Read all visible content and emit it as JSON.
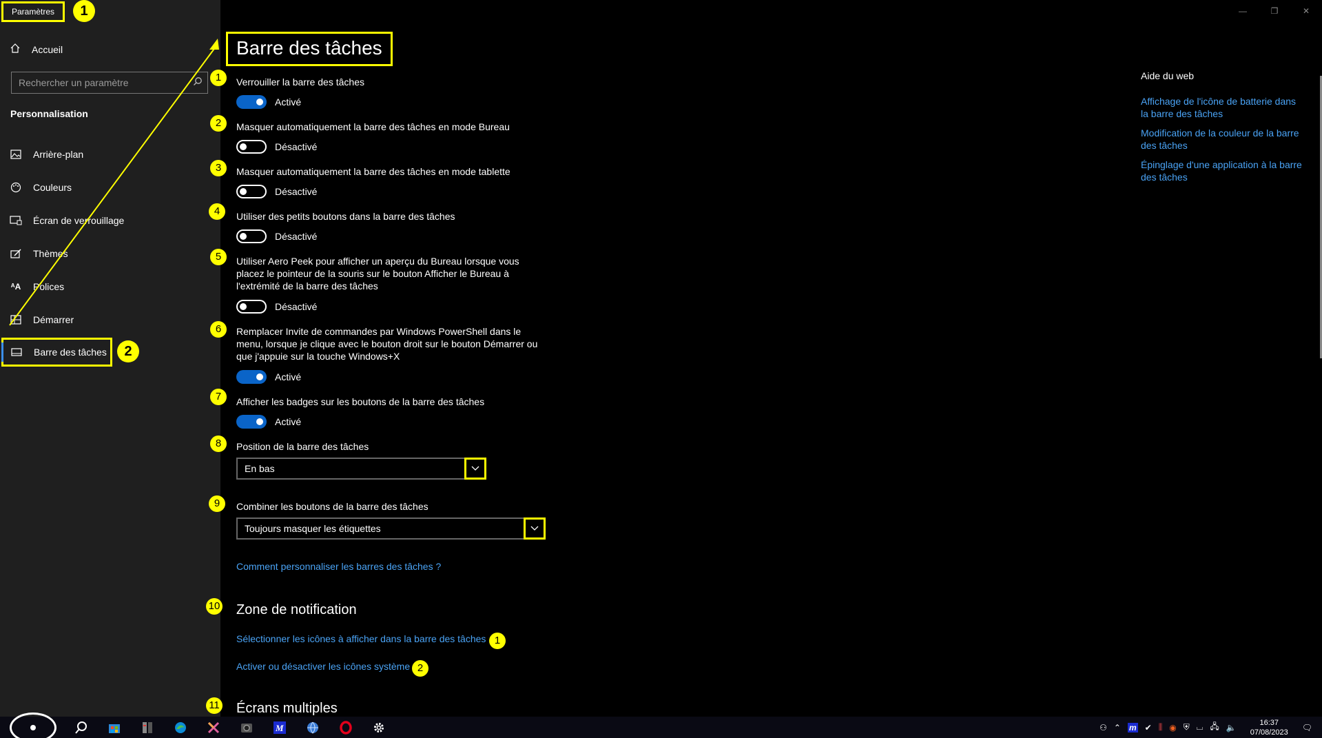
{
  "app": {
    "title": "Paramètres"
  },
  "annotations": {
    "app_title": "1",
    "active_nav": "2",
    "settings": [
      "1",
      "2",
      "3",
      "4",
      "5",
      "6",
      "7",
      "8",
      "9",
      "10",
      "11"
    ],
    "notif_links": [
      "1",
      "2"
    ]
  },
  "sidebar": {
    "home_label": "Accueil",
    "search_placeholder": "Rechercher un paramètre",
    "section": "Personnalisation",
    "items": [
      {
        "label": "Arrière-plan",
        "icon": "picture-icon"
      },
      {
        "label": "Couleurs",
        "icon": "palette-icon"
      },
      {
        "label": "Écran de verrouillage",
        "icon": "lock-screen-icon"
      },
      {
        "label": "Thèmes",
        "icon": "brush-icon"
      },
      {
        "label": "Polices",
        "icon": "font-icon"
      },
      {
        "label": "Démarrer",
        "icon": "start-icon"
      },
      {
        "label": "Barre des tâches",
        "icon": "taskbar-icon",
        "active": true
      }
    ]
  },
  "main": {
    "title": "Barre des tâches",
    "settings": [
      {
        "label": "Verrouiller la barre des tâches",
        "state": "Activé",
        "on": true
      },
      {
        "label": "Masquer automatiquement la barre des tâches en mode Bureau",
        "state": "Désactivé",
        "on": false
      },
      {
        "label": "Masquer automatiquement la barre des tâches en mode tablette",
        "state": "Désactivé",
        "on": false
      },
      {
        "label": "Utiliser des petits boutons dans la barre des tâches",
        "state": "Désactivé",
        "on": false
      },
      {
        "label_lines": [
          "Utiliser Aero Peek pour afficher un aperçu du Bureau lorsque vous",
          "placez le pointeur de la souris sur le bouton Afficher le Bureau à",
          "l'extrémité de la barre des tâches"
        ],
        "state": "Désactivé",
        "on": false
      },
      {
        "label_lines": [
          "Remplacer Invite de commandes par Windows PowerShell dans le",
          "menu, lorsque je clique avec le bouton droit sur le bouton Démarrer ou",
          "que j'appuie sur la touche Windows+X"
        ],
        "state": "Activé",
        "on": true
      },
      {
        "label": "Afficher les badges sur les boutons de la barre des tâches",
        "state": "Activé",
        "on": true
      }
    ],
    "position": {
      "label": "Position de la barre des tâches",
      "value": "En bas"
    },
    "combine": {
      "label": "Combiner les boutons de la barre des tâches",
      "value": "Toujours masquer les étiquettes"
    },
    "help_link": "Comment personnaliser les barres des tâches ?",
    "notification": {
      "title": "Zone de notification",
      "links": [
        "Sélectionner les icônes à afficher dans la barre des tâches",
        "Activer ou désactiver les icônes système"
      ]
    },
    "multi_screens": {
      "title": "Écrans multiples"
    }
  },
  "aside": {
    "title": "Aide du web",
    "links": [
      [
        "Affichage de l'icône de batterie dans",
        "la barre des tâches"
      ],
      [
        "Modification de la couleur de la barre",
        "des tâches"
      ],
      [
        "Épinglage d'une application à la barre",
        "des tâches"
      ]
    ]
  },
  "taskbar": {
    "icons": [
      "search-icon",
      "store-icon",
      "app-icon",
      "edge-icon",
      "x-app-icon",
      "camera-icon",
      "m-app-icon",
      "globe-icon",
      "opera-icon",
      "gear-icon"
    ],
    "time": "16:37",
    "date": "07/08/2023"
  },
  "colors": {
    "accent": "#0a64c8",
    "highlight": "#ffff00",
    "link": "#4aa3f5"
  }
}
